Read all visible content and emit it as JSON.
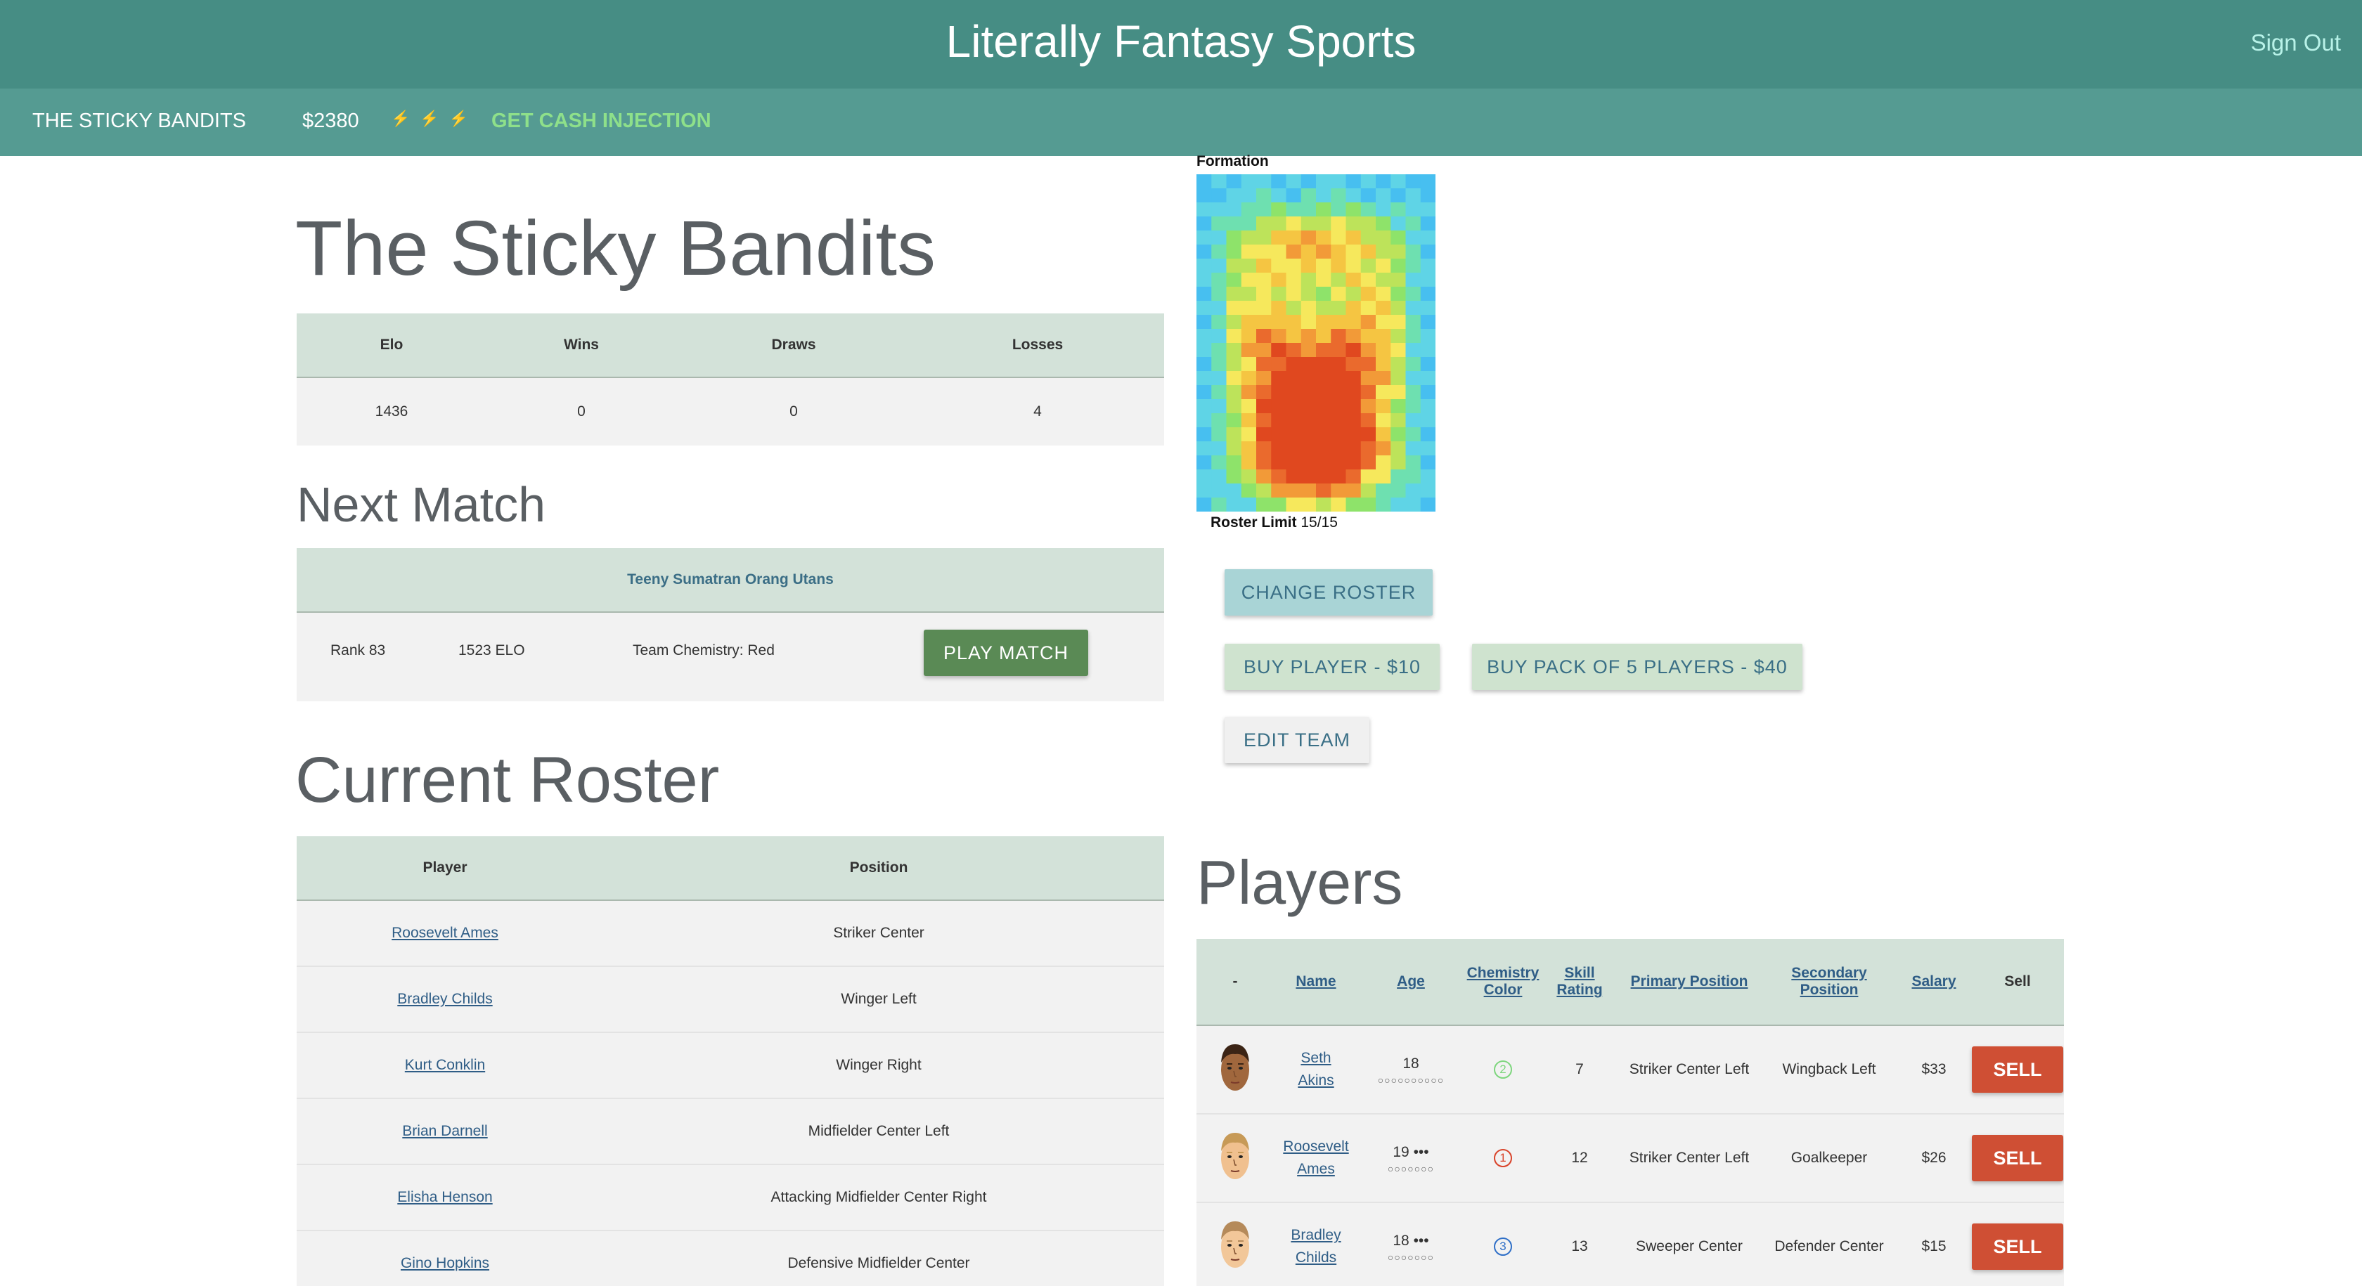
{
  "header": {
    "app_title": "Literally Fantasy Sports",
    "sign_out": "Sign Out",
    "colors": {
      "primary": "#468d84",
      "secondary": "#559b92"
    }
  },
  "subbar": {
    "team_name": "THE STICKY BANDITS",
    "cash": "$2380",
    "bolt_icons": [
      "lightning-icon",
      "lightning-icon",
      "lightning-icon"
    ],
    "bolt_glyph": "⚡",
    "cash_injection": "GET CASH INJECTION"
  },
  "team": {
    "title": "The Sticky Bandits",
    "stats_headers": [
      "Elo",
      "Wins",
      "Draws",
      "Losses"
    ],
    "stats_values": [
      "1436",
      "0",
      "0",
      "4"
    ]
  },
  "next_match": {
    "title": "Next Match",
    "opponent": "Teeny Sumatran Orang Utans",
    "rank": "Rank 83",
    "elo": "1523 ELO",
    "chemistry": "Team Chemistry: Red",
    "play_label": "PLAY MATCH"
  },
  "roster": {
    "title": "Current Roster",
    "headers": [
      "Player",
      "Position"
    ],
    "rows": [
      {
        "player": "Roosevelt Ames",
        "position": "Striker Center"
      },
      {
        "player": "Bradley Childs",
        "position": "Winger Left"
      },
      {
        "player": "Kurt Conklin",
        "position": "Winger Right"
      },
      {
        "player": "Brian Darnell",
        "position": "Midfielder Center Left"
      },
      {
        "player": "Elisha Henson",
        "position": "Attacking Midfielder Center Right"
      },
      {
        "player": "Gino Hopkins",
        "position": "Defensive Midfielder Center"
      }
    ]
  },
  "formation": {
    "label": "Formation",
    "roster_limit_label": "Roster Limit",
    "roster_limit_value": "15/15"
  },
  "actions": {
    "change_roster": "CHANGE ROSTER",
    "buy_player": "BUY PLAYER - $10",
    "buy_pack": "BUY PACK OF 5 PLAYERS - $40",
    "edit_team": "EDIT TEAM"
  },
  "players": {
    "title": "Players",
    "headers": {
      "dash": "-",
      "name": "Name",
      "age": "Age",
      "chem_1": "Chemistry",
      "chem_2": "Color",
      "skill_1": "Skill",
      "skill_2": "Rating",
      "primary": "Primary Position",
      "secondary_1": "Secondary",
      "secondary_2": "Position",
      "salary": "Salary",
      "sell": "Sell"
    },
    "sell_label": "SELL",
    "rows": [
      {
        "first": "Seth",
        "last": "Akins",
        "age": "18",
        "age_dots": "○○○○○○○○○○",
        "chem": "2",
        "chem_color": "#7ed67e",
        "skill": "7",
        "primary": "Striker Center Left",
        "secondary": "Wingback Left",
        "salary": "$33",
        "skin": "#a0673d",
        "hair": "#3b2415"
      },
      {
        "first": "Roosevelt",
        "last": "Ames",
        "age": "19 •••",
        "age_dots": "○○○○○○○",
        "chem": "1",
        "chem_color": "#d9442b",
        "skill": "12",
        "primary": "Striker Center Left",
        "secondary": "Goalkeeper",
        "salary": "$26",
        "skin": "#f0c08f",
        "hair": "#c79a57"
      },
      {
        "first": "Bradley",
        "last": "Childs",
        "age": "18 •••",
        "age_dots": "○○○○○○○",
        "chem": "3",
        "chem_color": "#2f6fc7",
        "skill": "13",
        "primary": "Sweeper Center",
        "secondary": "Defender Center",
        "salary": "$15",
        "skin": "#f2c799",
        "hair": "#b58a5a"
      }
    ]
  }
}
